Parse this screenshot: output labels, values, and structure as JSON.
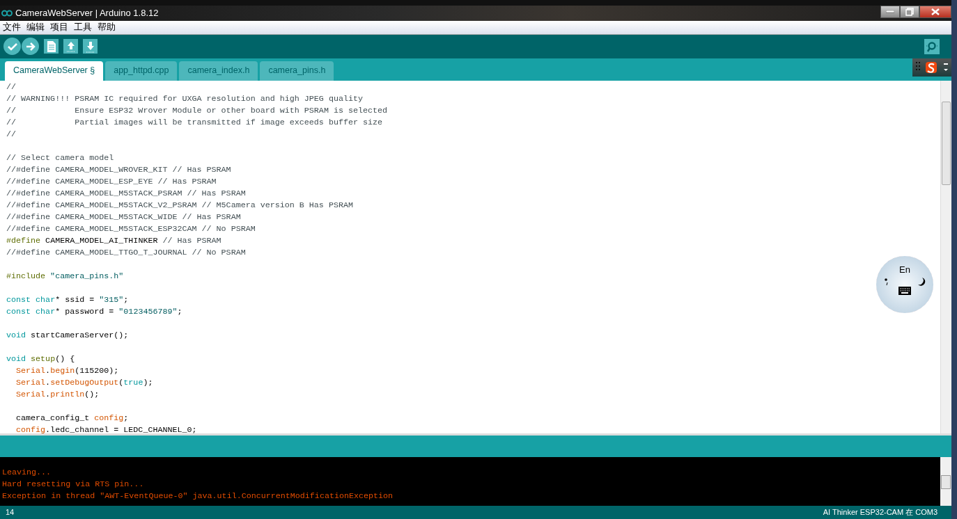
{
  "window": {
    "title": "CameraWebServer | Arduino 1.8.12"
  },
  "menu": [
    "文件",
    "编辑",
    "项目",
    "工具",
    "帮助"
  ],
  "toolbar": {
    "buttons": [
      {
        "kind": "verify"
      },
      {
        "kind": "upload"
      },
      {
        "kind": "new"
      },
      {
        "kind": "open"
      },
      {
        "kind": "save"
      }
    ],
    "right_button": {
      "kind": "serial-monitor"
    }
  },
  "tabs": [
    {
      "label": "CameraWebServer §",
      "selected": true
    },
    {
      "label": "app_httpd.cpp",
      "selected": false
    },
    {
      "label": "camera_index.h",
      "selected": false
    },
    {
      "label": "camera_pins.h",
      "selected": false
    }
  ],
  "editor": {
    "blocks": [
      [
        [
          {
            "text": "//",
            "kind": "comment"
          }
        ],
        [
          {
            "text": "// WARNING!!! PSRAM IC required for UXGA resolution and high JPEG quality",
            "kind": "comment"
          }
        ],
        [
          {
            "text": "//            Ensure ESP32 Wrover Module or other board with PSRAM is selected",
            "kind": "comment"
          }
        ],
        [
          {
            "text": "//            Partial images will be transmitted if image exceeds buffer size",
            "kind": "comment"
          }
        ],
        [
          {
            "text": "//",
            "kind": "comment"
          }
        ]
      ],
      [
        [
          {
            "text": "// Select camera model",
            "kind": "comment"
          }
        ],
        [
          {
            "text": "//#define CAMERA_MODEL_WROVER_KIT // Has PSRAM",
            "kind": "comment"
          }
        ],
        [
          {
            "text": "//#define CAMERA_MODEL_ESP_EYE // Has PSRAM",
            "kind": "comment"
          }
        ],
        [
          {
            "text": "//#define CAMERA_MODEL_M5STACK_PSRAM // Has PSRAM",
            "kind": "comment"
          }
        ],
        [
          {
            "text": "//#define CAMERA_MODEL_M5STACK_V2_PSRAM // M5Camera version B Has PSRAM",
            "kind": "comment"
          }
        ],
        [
          {
            "text": "//#define CAMERA_MODEL_M5STACK_WIDE // Has PSRAM",
            "kind": "comment"
          }
        ],
        [
          {
            "text": "//#define CAMERA_MODEL_M5STACK_ESP32CAM // No PSRAM",
            "kind": "comment"
          }
        ],
        [
          {
            "text": "#define",
            "kind": "preproc"
          },
          {
            "text": " CAMERA_MODEL_AI_THINKER",
            "kind": "plain"
          },
          {
            "text": " // Has PSRAM",
            "kind": "comment"
          }
        ],
        [
          {
            "text": "//#define CAMERA_MODEL_TTGO_T_JOURNAL // No PSRAM",
            "kind": "comment"
          }
        ]
      ],
      [
        [
          {
            "text": "#include",
            "kind": "preproc"
          },
          {
            "text": " \"camera_pins.h\"",
            "kind": "string"
          }
        ]
      ],
      [
        [
          {
            "text": "const ",
            "kind": "keyword"
          },
          {
            "text": "char",
            "kind": "keyword"
          },
          {
            "text": "* ssid = ",
            "kind": "plain"
          },
          {
            "text": "\"315\"",
            "kind": "string"
          },
          {
            "text": ";",
            "kind": "plain"
          }
        ],
        [
          {
            "text": "const ",
            "kind": "keyword"
          },
          {
            "text": "char",
            "kind": "keyword"
          },
          {
            "text": "* password = ",
            "kind": "plain"
          },
          {
            "text": "\"0123456789\"",
            "kind": "string"
          },
          {
            "text": ";",
            "kind": "plain"
          }
        ]
      ],
      [
        [
          {
            "text": "void",
            "kind": "keyword"
          },
          {
            "text": " startCameraServer();",
            "kind": "plain"
          }
        ]
      ],
      [
        [
          {
            "text": "void ",
            "kind": "keyword"
          },
          {
            "text": "setup",
            "kind": "preproc"
          },
          {
            "text": "() {",
            "kind": "plain"
          }
        ],
        [
          {
            "text": "  Serial",
            "kind": "function"
          },
          {
            "text": ".",
            "kind": "plain"
          },
          {
            "text": "begin",
            "kind": "function"
          },
          {
            "text": "(115200);",
            "kind": "plain"
          }
        ],
        [
          {
            "text": "  Serial",
            "kind": "function"
          },
          {
            "text": ".",
            "kind": "plain"
          },
          {
            "text": "setDebugOutput",
            "kind": "function"
          },
          {
            "text": "(",
            "kind": "plain"
          },
          {
            "text": "true",
            "kind": "keyword"
          },
          {
            "text": ");",
            "kind": "plain"
          }
        ],
        [
          {
            "text": "  Serial",
            "kind": "function"
          },
          {
            "text": ".",
            "kind": "plain"
          },
          {
            "text": "println",
            "kind": "function"
          },
          {
            "text": "();",
            "kind": "plain"
          }
        ]
      ],
      [
        [
          {
            "text": "  camera_config_t ",
            "kind": "plain"
          },
          {
            "text": "config",
            "kind": "function"
          },
          {
            "text": ";",
            "kind": "plain"
          }
        ],
        [
          {
            "text": "  config",
            "kind": "function"
          },
          {
            "text": ".ledc_channel = LEDC_CHANNEL_0;",
            "kind": "plain"
          }
        ]
      ]
    ]
  },
  "console": {
    "lines": [
      "Leaving...",
      "Hard resetting via RTS pin...",
      "Exception in thread \"AWT-EventQueue-0\" java.util.ConcurrentModificationException"
    ]
  },
  "status_bar": {
    "line_number": "14",
    "board": "AI Thinker ESP32-CAM 在 COM3"
  },
  "ime": {
    "language": "En"
  }
}
